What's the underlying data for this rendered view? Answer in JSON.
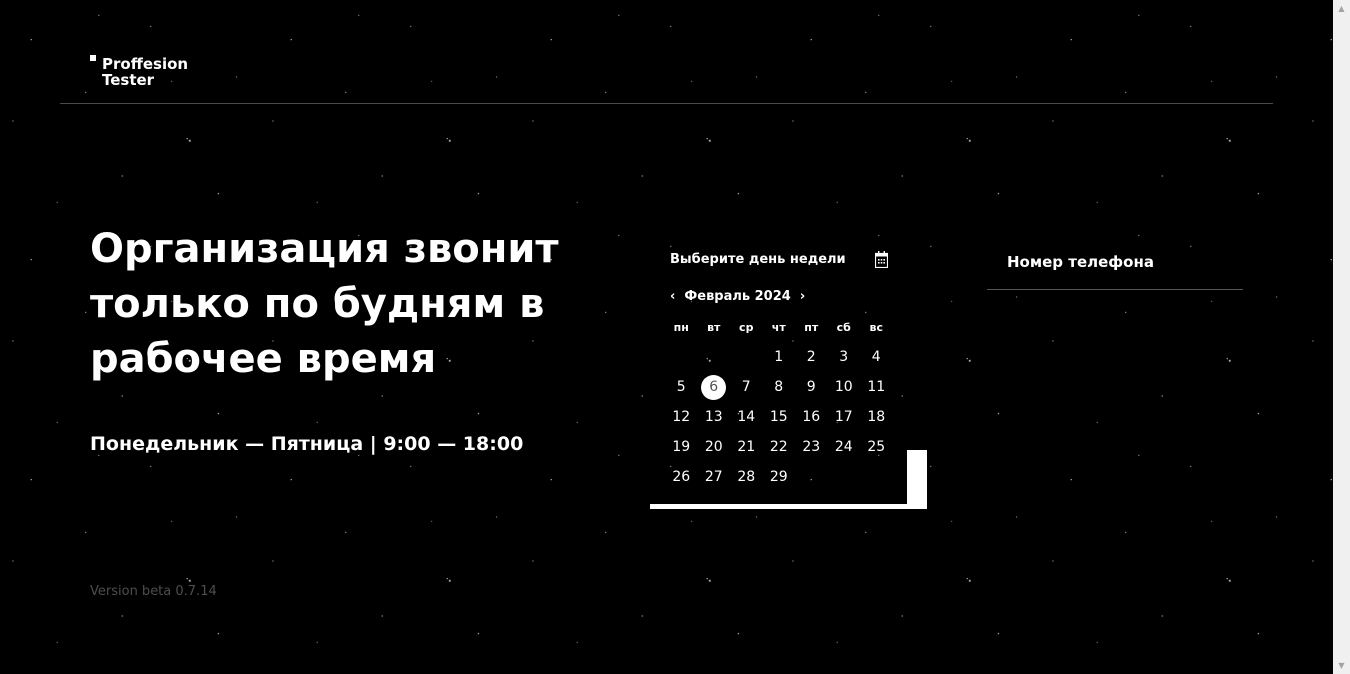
{
  "brand": {
    "line1": "Proffesion",
    "line2": "Tester"
  },
  "hero": {
    "title": "Организация звонит только по будням в рабочее время",
    "hours": "Понедельник — Пятница | 9:00 — 18:00"
  },
  "version": "Version beta 0.7.14",
  "calendar": {
    "label": "Выберите день недели",
    "month": "Февраль 2024",
    "prev_icon": "chevron-left-icon",
    "next_icon": "chevron-right-icon",
    "weekdays": [
      "пн",
      "вт",
      "ср",
      "чт",
      "пт",
      "сб",
      "вс"
    ],
    "leading_blanks": 3,
    "days": [
      "1",
      "2",
      "3",
      "4",
      "5",
      "6",
      "7",
      "8",
      "9",
      "10",
      "11",
      "12",
      "13",
      "14",
      "15",
      "16",
      "17",
      "18",
      "19",
      "20",
      "21",
      "22",
      "23",
      "24",
      "25",
      "26",
      "27",
      "28",
      "29"
    ],
    "selected_day": "6"
  },
  "phone": {
    "label": "Номер телефона"
  },
  "colors": {
    "background": "#000000",
    "text": "#ffffff",
    "muted": "#4d4d4d",
    "divider": "#4a4a4a"
  }
}
